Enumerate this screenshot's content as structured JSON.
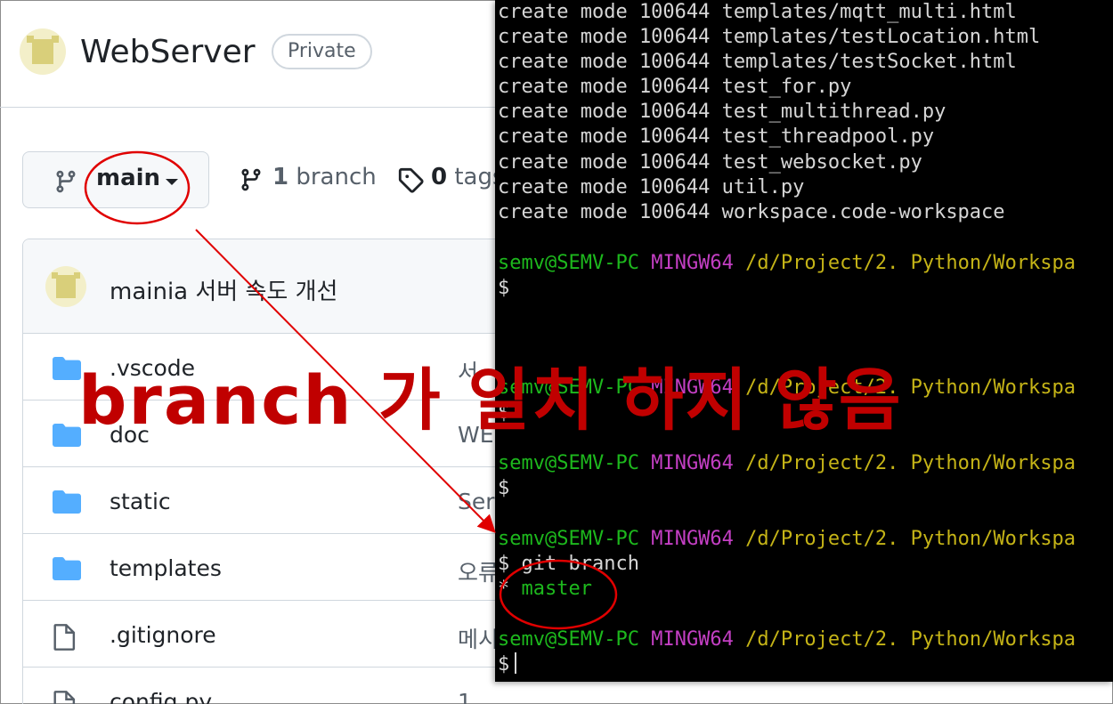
{
  "repo": {
    "name": "WebServer",
    "visibility": "Private"
  },
  "branch_bar": {
    "current_branch": "main",
    "branch_count": "1",
    "branch_word": "branch",
    "tag_count": "0",
    "tag_word": "tags"
  },
  "commit": {
    "message": "mainia 서버 속도 개선"
  },
  "files": [
    {
      "name": ".vscode",
      "type": "folder",
      "commit": "서"
    },
    {
      "name": "doc",
      "type": "folder",
      "commit": "WE"
    },
    {
      "name": "static",
      "type": "folder",
      "commit": "Ser"
    },
    {
      "name": "templates",
      "type": "folder",
      "commit": "오류"
    },
    {
      "name": ".gitignore",
      "type": "file",
      "commit": "메시"
    },
    {
      "name": "config.py",
      "type": "file",
      "commit": "1"
    }
  ],
  "terminal": {
    "create_lines": [
      "create mode 100644 templates/mqtt_multi.html",
      "create mode 100644 templates/testLocation.html",
      "create mode 100644 templates/testSocket.html",
      "create mode 100644 test_for.py",
      "create mode 100644 test_multithread.py",
      "create mode 100644 test_threadpool.py",
      "create mode 100644 test_websocket.py",
      "create mode 100644 util.py",
      "create mode 100644 workspace.code-workspace"
    ],
    "user_host": "semv@SEMV-PC",
    "shell": "MINGW64",
    "path": "/d/Project/2. Python/Workspa",
    "prompt": "$",
    "command": "git branch",
    "branch_marker": "*",
    "branch_output": "master"
  },
  "annotation": {
    "text": "branch 가 일치 하지 않음",
    "color": "#c00000"
  },
  "colors": {
    "terminal_bg": "#000000",
    "user_host": "#1db81d",
    "shell": "#c43fc4",
    "path": "#c5b417",
    "github_border": "#d0d7de",
    "folder": "#54aeff"
  }
}
